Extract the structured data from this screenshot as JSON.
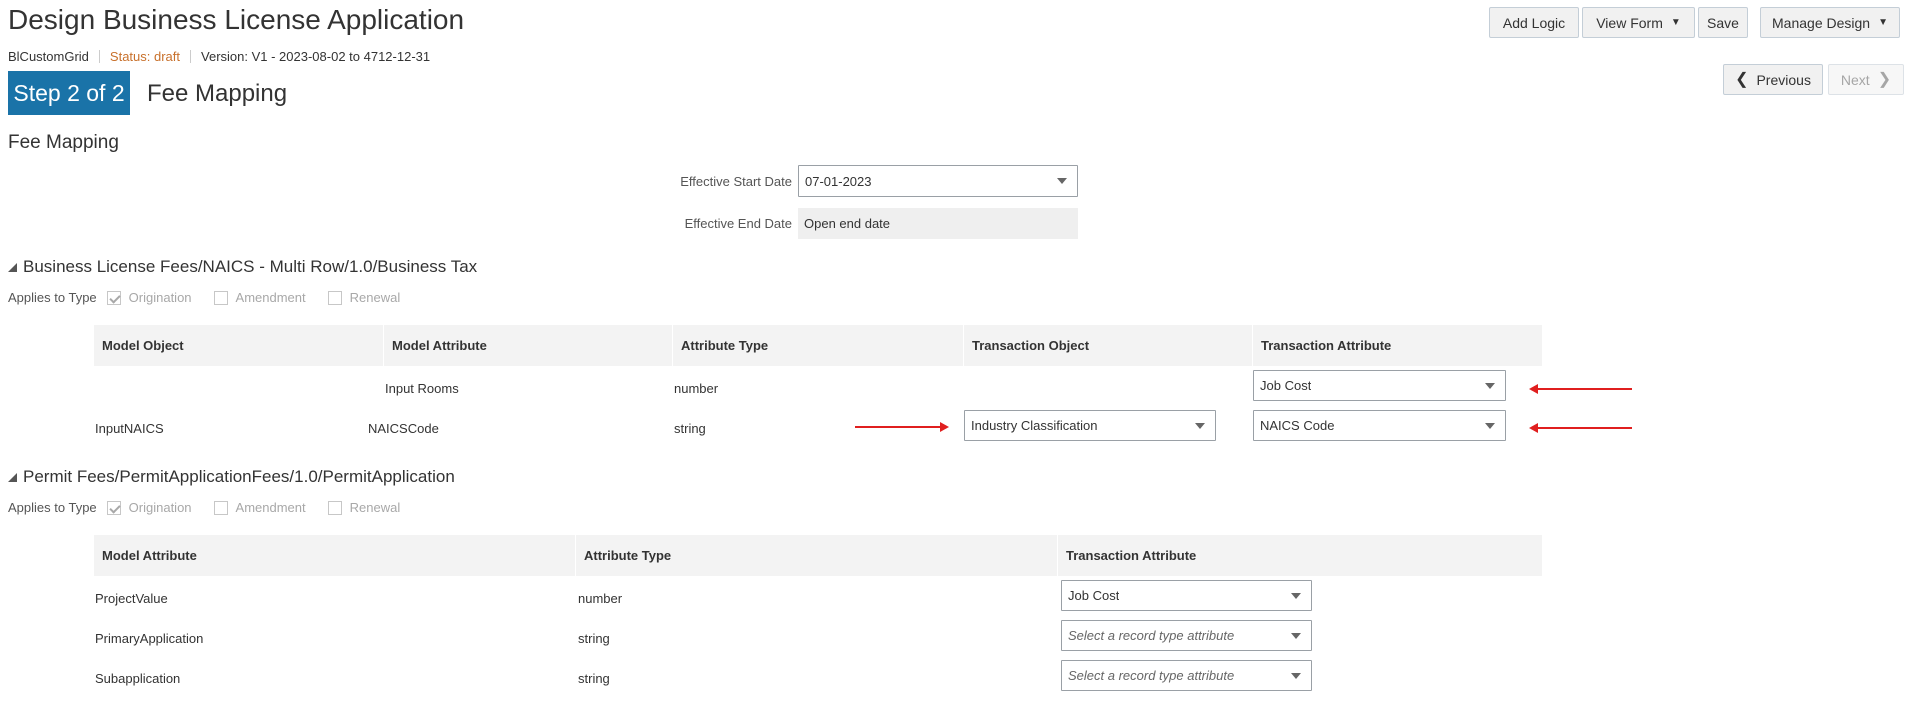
{
  "header": {
    "title": "Design Business License Application",
    "grid_name": "BlCustomGrid",
    "status": "Status: draft",
    "version": "Version: V1 - 2023-08-02 to 4712-12-31"
  },
  "toolbar": {
    "add_logic": "Add Logic",
    "view_form": "View Form",
    "save": "Save",
    "manage_design": "Manage Design"
  },
  "nav": {
    "previous": "Previous",
    "next": "Next"
  },
  "step": {
    "badge": "Step 2 of 2",
    "title": "Fee Mapping"
  },
  "section": {
    "heading": "Fee Mapping",
    "effective_start_label": "Effective Start Date",
    "effective_start_value": "07-01-2023",
    "effective_end_label": "Effective End Date",
    "effective_end_value": "Open end date"
  },
  "group1": {
    "heading": "Business License Fees/NAICS - Multi Row/1.0/Business Tax",
    "applies_label": "Applies to Type",
    "types": [
      {
        "label": "Origination",
        "checked": true
      },
      {
        "label": "Amendment",
        "checked": false
      },
      {
        "label": "Renewal",
        "checked": false
      }
    ],
    "columns": [
      "Model Object",
      "Model Attribute",
      "Attribute Type",
      "Transaction Object",
      "Transaction Attribute"
    ],
    "rows": [
      {
        "model_object": "",
        "model_attribute": "Input Rooms",
        "attribute_type": "number",
        "transaction_object": "",
        "transaction_attribute": "Job Cost"
      },
      {
        "model_object": "InputNAICS",
        "model_attribute": "NAICSCode",
        "attribute_type": "string",
        "transaction_object": "Industry Classification",
        "transaction_attribute": "NAICS Code"
      }
    ]
  },
  "group2": {
    "heading": "Permit Fees/PermitApplicationFees/1.0/PermitApplication",
    "applies_label": "Applies to Type",
    "types": [
      {
        "label": "Origination",
        "checked": true
      },
      {
        "label": "Amendment",
        "checked": false
      },
      {
        "label": "Renewal",
        "checked": false
      }
    ],
    "columns": [
      "Model Attribute",
      "Attribute Type",
      "Transaction Attribute"
    ],
    "rows": [
      {
        "model_attribute": "ProjectValue",
        "attribute_type": "number",
        "transaction_attribute": "Job Cost"
      },
      {
        "model_attribute": "PrimaryApplication",
        "attribute_type": "string",
        "transaction_attribute": "",
        "placeholder": "Select a record type attribute"
      },
      {
        "model_attribute": "Subapplication",
        "attribute_type": "string",
        "transaction_attribute": "",
        "placeholder": "Select a record type attribute"
      }
    ]
  },
  "colors": {
    "step_badge": "#1a73a8",
    "status": "#c8702b",
    "annotation_arrow": "#e01f1f"
  }
}
